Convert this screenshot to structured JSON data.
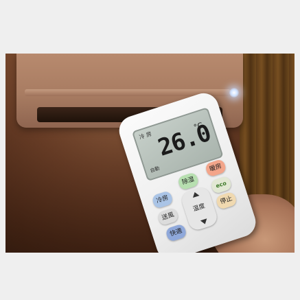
{
  "remote": {
    "display": {
      "top_text": "冷 房",
      "temperature": "26.0",
      "unit": "°C",
      "bottom_text": "自動"
    },
    "buttons": {
      "cool": "冷房",
      "dry": "除湿",
      "heat": "暖房",
      "fan": "送風",
      "eco": "eco",
      "stop": "停止",
      "comfort": "快適",
      "temp": "温度"
    }
  },
  "colors": {
    "wall": "#6b3f28",
    "ac_body": "#a87c62",
    "ac_led": "#cfe2ff",
    "remote_body": "#f2f2f2",
    "lcd": "#b4beb7"
  }
}
